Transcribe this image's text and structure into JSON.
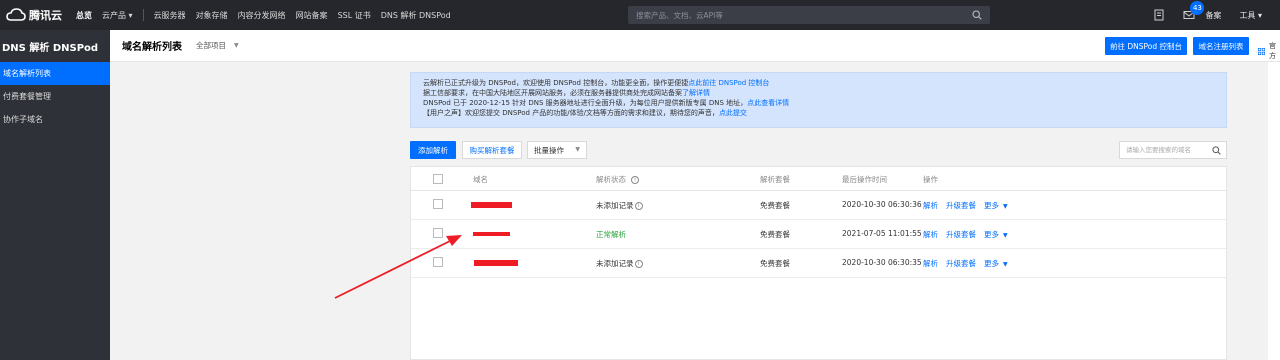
{
  "topnav": {
    "brand": "腾讯云",
    "links": [
      "总览",
      "云产品",
      "云服务器",
      "对象存储",
      "内容分发网络",
      "网站备案",
      "SSL 证书",
      "DNS 解析 DNSPod"
    ],
    "search_placeholder": "搜索产品、文档、云API等",
    "message_count": "43",
    "beian": "备案",
    "tools": "工具"
  },
  "sidebar": {
    "title": "DNS 解析 DNSPod",
    "items": [
      "域名解析列表",
      "付费套餐管理",
      "协作子域名"
    ]
  },
  "header": {
    "title": "域名解析列表",
    "project": "全部项目",
    "btn_console": "前往 DNSPod 控制台",
    "btn_register": "域名注册列表",
    "extra": "官方"
  },
  "notice": {
    "line1": "云解析已正式升级为 DNSPod，欢迎使用 DNSPod 控制台，功能更全面，操作更便捷",
    "line1_link": "点此前往 DNSPod 控制台",
    "line2": "据工信部要求，在中国大陆地区开展网站服务，必须在服务器提供商处完成网站备案",
    "line2_link": "了解详情",
    "line3": "DNSPod 已于 2020-12-15 针对 DNS 服务器地址进行全面升级，为每位用户提供新版专属 DNS 地址，",
    "line3_link": "点此查看详情",
    "line4": "【用户之声】欢迎您提交 DNSPod 产品的功能/体验/文档等方面的需求和建议，期待您的声音，",
    "line4_link": "点此提交"
  },
  "toolbar": {
    "add": "添加解析",
    "buy": "购买解析套餐",
    "batch": "批量操作",
    "search_placeholder": "请输入您要搜索的域名"
  },
  "table": {
    "headers": {
      "domain": "域名",
      "status": "解析状态",
      "package": "解析套餐",
      "last_op": "最后操作时间",
      "ops": "操作"
    },
    "rows": [
      {
        "status": "未添加记录",
        "package": "免费套餐",
        "time": "2020-10-30 06:30:36",
        "op1": "解析",
        "op2": "升级套餐",
        "op3": "更多"
      },
      {
        "status": "正常解析",
        "package": "免费套餐",
        "time": "2021-07-05 11:01:55",
        "op1": "解析",
        "op2": "升级套餐",
        "op3": "更多"
      },
      {
        "status": "未添加记录",
        "package": "免费套餐",
        "time": "2020-10-30 06:30:35",
        "op1": "解析",
        "op2": "升级套餐",
        "op3": "更多"
      }
    ]
  },
  "colors": {
    "primary": "#006eff",
    "nav_bg": "#25272d",
    "sidebar_bg": "#2f3138",
    "redaction": "#ee1c25",
    "status_ok": "#29a33a"
  }
}
